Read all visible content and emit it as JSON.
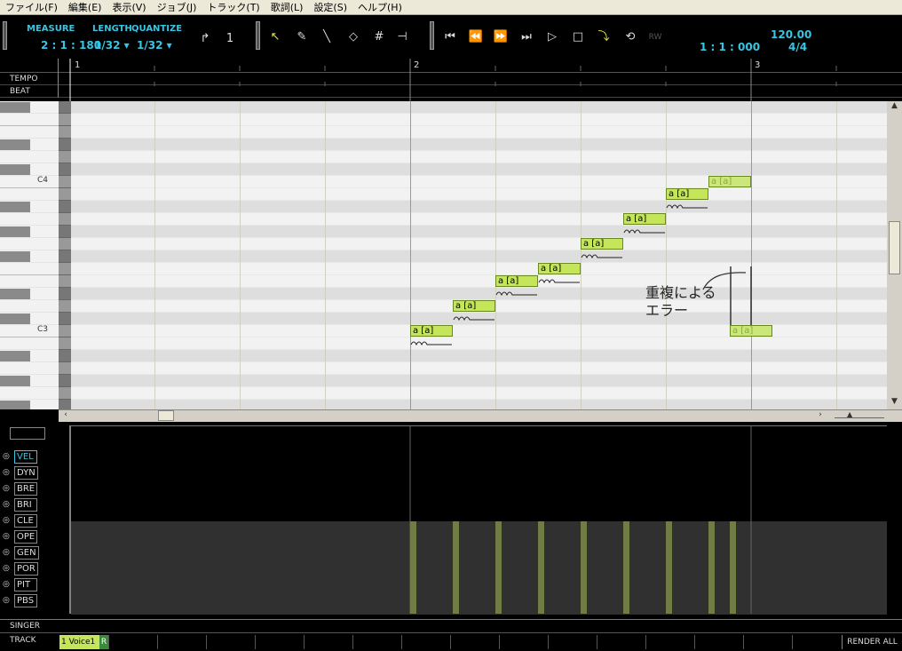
{
  "menu": [
    "ファイル(F)",
    "編集(E)",
    "表示(V)",
    "ジョブ(J)",
    "トラック(T)",
    "歌詞(L)",
    "設定(S)",
    "ヘルプ(H)"
  ],
  "toolbar": {
    "measure_label": "MEASURE",
    "measure_value": "2 : 1 : 180",
    "length_label": "LENGTH",
    "length_value": "1/32 ▾",
    "quantize_label": "QUANTIZE",
    "quantize_value": "1/32 ▾",
    "position": "1 : 1 : 000",
    "tempo": "120.00",
    "signature": "4/4",
    "tool_icons": [
      "start-marker-icon",
      "end-marker-icon",
      "arrow-icon",
      "pencil-icon",
      "line-icon",
      "eraser-icon",
      "grid-icon",
      "curve-icon"
    ],
    "transport_icons": [
      "go-start-icon",
      "rewind-icon",
      "fast-forward-icon",
      "go-end-icon",
      "play-icon",
      "stop-icon",
      "auto-scroll-icon",
      "loop-icon",
      "rewrite-icon"
    ],
    "rw_label": "RW"
  },
  "ruler": {
    "measures": [
      "1",
      "2",
      "3"
    ]
  },
  "rows": {
    "tempo": "TEMPO",
    "beat": "BEAT"
  },
  "keyboard": {
    "c4": "C4",
    "c3": "C3"
  },
  "notes": [
    {
      "lyric": "a [a]",
      "pitch": "C3"
    },
    {
      "lyric": "a [a]",
      "pitch": "D3"
    },
    {
      "lyric": "a [a]",
      "pitch": "E3"
    },
    {
      "lyric": "a [a]",
      "pitch": "F3"
    },
    {
      "lyric": "a [a]",
      "pitch": "G3"
    },
    {
      "lyric": "a [a]",
      "pitch": "A3"
    },
    {
      "lyric": "a [a]",
      "pitch": "B3"
    },
    {
      "lyric": "a [a]",
      "pitch": "C4"
    },
    {
      "lyric": "a [a]",
      "pitch": "C3"
    }
  ],
  "annotation": "重複による\nエラー",
  "controllers": [
    "VEL",
    "DYN",
    "BRE",
    "BRI",
    "CLE",
    "OPE",
    "GEN",
    "POR",
    "PIT",
    "PBS"
  ],
  "bottom": {
    "singer": "SINGER",
    "track": "TRACK",
    "track_tab": "1 Voice1",
    "track_r": "R",
    "render_all": "RENDER ALL"
  },
  "colors": {
    "accent": "#37c5e3",
    "note_fill": "#c5e55a",
    "vel_bar": "#6f7d45"
  }
}
